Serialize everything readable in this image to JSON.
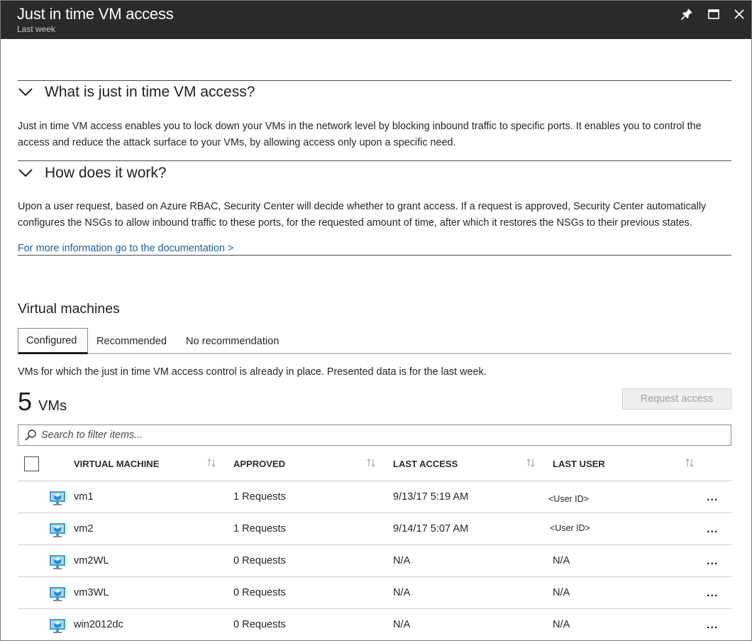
{
  "window": {
    "title": "Just in time VM access",
    "subtitle": "Last week"
  },
  "sections": [
    {
      "heading": "What is just in time VM access?",
      "text": "Just in time VM access enables you to lock down your VMs in the network level by blocking inbound traffic to specific ports. It enables you to control the access and reduce the attack surface to your VMs, by allowing access only upon a specific need."
    },
    {
      "heading": "How does it work?",
      "text": "Upon a user request, based on Azure RBAC, Security Center will decide whether to grant access. If a request is approved, Security Center automatically configures the NSGs to allow inbound traffic to these ports, for the requested amount of time, after which it restores the NSGs to their previous states."
    }
  ],
  "doc_link": "For more information go to the documentation >",
  "vm_section": {
    "heading": "Virtual machines",
    "tabs": [
      "Configured",
      "Recommended",
      "No recommendation"
    ],
    "active_tab": "Configured",
    "description": "VMs for which the just in time VM access control is already in place. Presented data is for the last week.",
    "count_number": "5",
    "count_unit": "VMs",
    "request_button": "Request access",
    "search_placeholder": "Search to filter items...",
    "columns": [
      "VIRTUAL MACHINE",
      "APPROVED",
      "LAST ACCESS",
      "LAST USER"
    ],
    "rows": [
      {
        "name": "vm1",
        "approved": "1 Requests",
        "last_access": "9/13/17 5:19 AM",
        "last_user": "<User ID>"
      },
      {
        "name": "vm2",
        "approved": "1 Requests",
        "last_access": "9/14/17 5:07 AM",
        "last_user": "<User ID>"
      },
      {
        "name": "vm2WL",
        "approved": "0 Requests",
        "last_access": "N/A",
        "last_user": "N/A"
      },
      {
        "name": "vm3WL",
        "approved": "0 Requests",
        "last_access": "N/A",
        "last_user": "N/A"
      },
      {
        "name": "win2012dc",
        "approved": "0 Requests",
        "last_access": "N/A",
        "last_user": "N/A"
      }
    ],
    "row_menu": "..."
  },
  "icons": {
    "pin": "pin-icon",
    "maximize": "maximize-icon",
    "close": "close-icon",
    "chevron": "chevron-down-icon",
    "search": "search-icon",
    "sort": "sort-icon",
    "vm": "virtual-machine-icon"
  },
  "colors": {
    "titlebar": "#2b2b2b",
    "link": "#1a5f9e",
    "vm_icon": "#3aa0d6"
  }
}
